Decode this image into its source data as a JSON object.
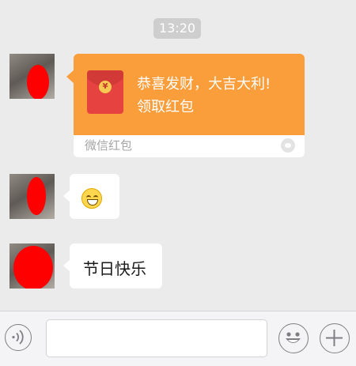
{
  "chat": {
    "timestamp": "13:20",
    "messages": [
      {
        "type": "red-packet",
        "greeting": "恭喜发财，大吉大利!",
        "action": "领取红包",
        "footer": "微信红包",
        "envelope_symbol": "¥"
      },
      {
        "type": "emoji",
        "emoji": "grinning-face"
      },
      {
        "type": "text",
        "text": "节日快乐"
      }
    ]
  },
  "colors": {
    "chat_background": "#ebebeb",
    "red_packet_orange": "#fa9d3b",
    "envelope_red": "#e64340",
    "redaction_red": "#ff0000"
  },
  "input_bar": {
    "voice_icon": "voice-icon",
    "emoji_icon": "emoji-icon",
    "plus_icon": "plus-icon"
  }
}
